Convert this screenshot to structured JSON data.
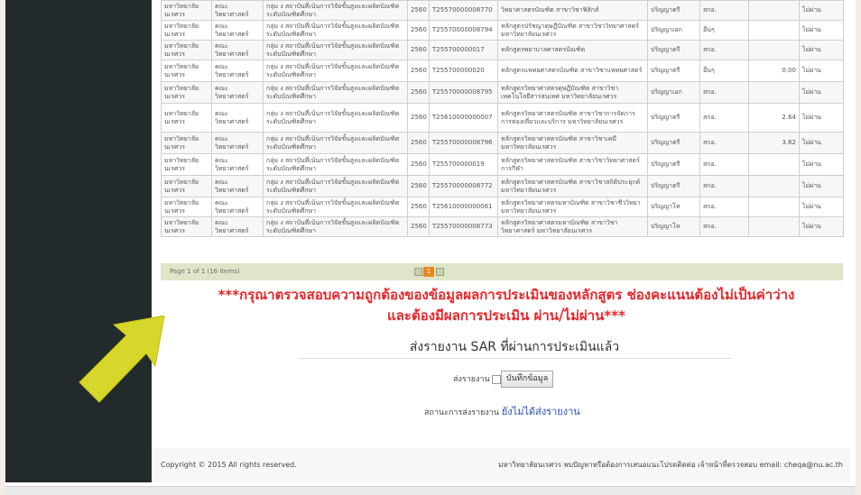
{
  "table": {
    "rows": [
      [
        "มหาวิทยาลัยนเรศวร",
        "คณะวิทยาศาสตร์",
        "กลุ่ม ง สถาบันที่เน้นการวิจัยขั้นสูงและผลิตบัณฑิตระดับบัณฑิตศึกษา",
        "2560",
        "T25570000008770",
        "วิทยาศาสตรบัณฑิต สาขาวิชาฟิสิกส์",
        "ปริญญาตรี",
        "สกอ.",
        "",
        "ไม่ผ่าน"
      ],
      [
        "มหาวิทยาลัยนเรศวร",
        "คณะวิทยาศาสตร์",
        "กลุ่ม ง สถาบันที่เน้นการวิจัยขั้นสูงและผลิตบัณฑิตระดับบัณฑิตศึกษา",
        "2560",
        "T25570000008794",
        "หลักสูตรปรัชญาดุษฎีบัณฑิต สาขาวิชาวิทยาศาสตร์ มหาวิทยาลัยนเรศวร",
        "ปริญญาเอก",
        "อื่นๆ",
        "",
        "ไม่ผ่าน"
      ],
      [
        "มหาวิทยาลัยนเรศวร",
        "คณะวิทยาศาสตร์",
        "กลุ่ม ง สถาบันที่เน้นการวิจัยขั้นสูงและผลิตบัณฑิตระดับบัณฑิตศึกษา",
        "2560",
        "T255700000017",
        "หลักสูตรพยาบาลศาสตรบัณฑิต",
        "ปริญญาตรี",
        "สกอ.",
        "",
        "ไม่ผ่าน"
      ],
      [
        "มหาวิทยาลัยนเรศวร",
        "คณะวิทยาศาสตร์",
        "กลุ่ม ง สถาบันที่เน้นการวิจัยขั้นสูงและผลิตบัณฑิตระดับบัณฑิตศึกษา",
        "2560",
        "T255700000020",
        "หลักสูตรแพทยศาสตรบัณฑิต สาขาวิชาแพทยศาสตร์",
        "ปริญญาตรี",
        "อื่นๆ",
        "0.00",
        "ไม่ผ่าน"
      ],
      [
        "มหาวิทยาลัยนเรศวร",
        "คณะวิทยาศาสตร์",
        "กลุ่ม ง สถาบันที่เน้นการวิจัยขั้นสูงและผลิตบัณฑิตระดับบัณฑิตศึกษา",
        "2560",
        "T25570000008795",
        "หลักสูตรวิทยาศาสตรดุษฎีบัณฑิต สาขาวิชาเทคโนโลยีสารสนเทศ มหาวิทยาลัยนเรศวร",
        "ปริญญาเอก",
        "สกอ.",
        "",
        "ไม่ผ่าน"
      ],
      [
        "มหาวิทยาลัยนเรศวร",
        "คณะวิทยาศาสตร์",
        "กลุ่ม ง สถาบันที่เน้นการวิจัยขั้นสูงและผลิตบัณฑิตระดับบัณฑิตศึกษา",
        "2560",
        "T25610000000007",
        "หลักสูตรวิทยาศาสตรบัณฑิต สาขาวิชาการจัดการการท่องเที่ยวและบริการ มหาวิทยาลัยนเรศวร",
        "ปริญญาตรี",
        "สกอ.",
        "2.64",
        "ไม่ผ่าน"
      ],
      [
        "มหาวิทยาลัยนเรศวร",
        "คณะวิทยาศาสตร์",
        "กลุ่ม ง สถาบันที่เน้นการวิจัยขั้นสูงและผลิตบัณฑิตระดับบัณฑิตศึกษา",
        "2560",
        "T25570000008796",
        "หลักสูตรวิทยาศาสตรบัณฑิต สาขาวิชาเคมี มหาวิทยาลัยนเรศวร",
        "ปริญญาตรี",
        "สกอ.",
        "3.62",
        "ไม่ผ่าน"
      ],
      [
        "มหาวิทยาลัยนเรศวร",
        "คณะวิทยาศาสตร์",
        "กลุ่ม ง สถาบันที่เน้นการวิจัยขั้นสูงและผลิตบัณฑิตระดับบัณฑิตศึกษา",
        "2560",
        "T255700000019",
        "หลักสูตรวิทยาศาสตรบัณฑิต สาขาวิชาวิทยาศาสตร์การกีฬา",
        "ปริญญาตรี",
        "สกอ.",
        "",
        "ไม่ผ่าน"
      ],
      [
        "มหาวิทยาลัยนเรศวร",
        "คณะวิทยาศาสตร์",
        "กลุ่ม ง สถาบันที่เน้นการวิจัยขั้นสูงและผลิตบัณฑิตระดับบัณฑิตศึกษา",
        "2560",
        "T25570000008772",
        "หลักสูตรวิทยาศาสตรบัณฑิต สาขาวิชาสถิติประยุกต์ มหาวิทยาลัยนเรศวร",
        "ปริญญาตรี",
        "สกอ.",
        "",
        "ไม่ผ่าน"
      ],
      [
        "มหาวิทยาลัยนเรศวร",
        "คณะวิทยาศาสตร์",
        "กลุ่ม ง สถาบันที่เน้นการวิจัยขั้นสูงและผลิตบัณฑิตระดับบัณฑิตศึกษา",
        "2560",
        "T25610000000061",
        "หลักสูตรวิทยาศาสตรมหาบัณฑิต สาขาวิชาชีววิทยา มหาวิทยาลัยนเรศวร",
        "ปริญญาโท",
        "สกอ.",
        "",
        "ไม่ผ่าน"
      ],
      [
        "มหาวิทยาลัยนเรศวร",
        "คณะวิทยาศาสตร์",
        "กลุ่ม ง สถาบันที่เน้นการวิจัยขั้นสูงและผลิตบัณฑิตระดับบัณฑิตศึกษา",
        "2560",
        "T25570000008773",
        "หลักสูตรวิทยาศาสตรมหาบัณฑิต สาขาวิชาวิทยาศาสตร์ มหาวิทยาลัยนเรศวร",
        "ปริญญาโท",
        "สกอ.",
        "",
        "ไม่ผ่าน"
      ]
    ]
  },
  "pager": {
    "label": "Page 1 of 1 (16 items)",
    "current": "1"
  },
  "warning": {
    "line1": "***กรุณาตรวจสอบความถูกต้องของข้อมูลผลการประเมินของหลักสูตร ช่องคะแนนต้องไม่เป็นค่าว่าง",
    "line2": "และต้องมีผลการประเมิน ผ่าน/ไม่ผ่าน***"
  },
  "submit": {
    "title": "ส่งรายงาน SAR ที่ผ่านการประเมินแล้ว",
    "checkbox_label": "ส่งรายงาน",
    "save_label": "บันทึกข้อมูล",
    "status_label": "สถานะการส่งรายงาน",
    "status_value": "ยังไม่ได้ส่งรายงาน"
  },
  "footer": {
    "copyright": "Copyright © 2015 All rights reserved.",
    "contact": "มหาวิทยาลัยนเรศวร พบปัญหาหรือต้องการเสนอแนะโปรดติดต่อ เจ้าหน้าที่ตรวจสอบ email: cheqa@nu.ac.th"
  },
  "colors": {
    "sidebar": "#232a2b",
    "warning": "#e8262a",
    "arrow": "#d7d62a",
    "status_link": "#2a4fbf",
    "pager_bg": "#dfe5c9"
  },
  "icons": {
    "arrow": "yellow-arrow-icon"
  }
}
